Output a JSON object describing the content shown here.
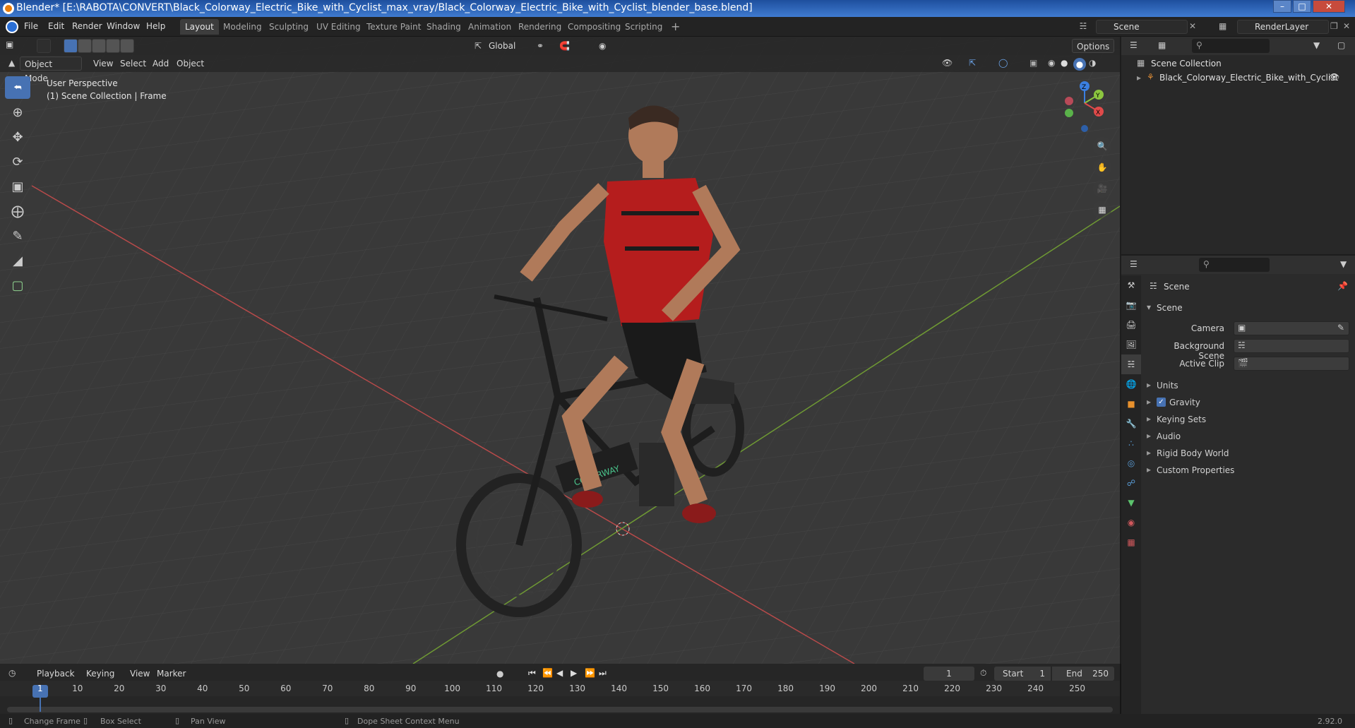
{
  "window": {
    "title": "Blender* [E:\\RABOTA\\CONVERT\\Black_Colorway_Electric_Bike_with_Cyclist_max_vray/Black_Colorway_Electric_Bike_with_Cyclist_blender_base.blend]"
  },
  "menubar": {
    "file": "File",
    "edit": "Edit",
    "render": "Render",
    "window": "Window",
    "help": "Help"
  },
  "workspaces": [
    "Layout",
    "Modeling",
    "Sculpting",
    "UV Editing",
    "Texture Paint",
    "Shading",
    "Animation",
    "Rendering",
    "Compositing",
    "Scripting"
  ],
  "scene_selector": {
    "value": "Scene"
  },
  "renderlayer_selector": {
    "value": "RenderLayer"
  },
  "viewport": {
    "mode": "Object Mode",
    "menus": {
      "view": "View",
      "select": "Select",
      "add": "Add",
      "object": "Object"
    },
    "transform_orientation": "Global",
    "options_label": "Options",
    "overlay_line1": "User Perspective",
    "overlay_line2": "(1) Scene Collection | Frame",
    "gizmo_axes": {
      "x": "X",
      "y": "Y",
      "z": "Z"
    }
  },
  "outliner": {
    "collection": "Scene Collection",
    "items": [
      {
        "label": "Black_Colorway_Electric_Bike_with_Cyclist"
      }
    ]
  },
  "properties": {
    "context": "Scene",
    "panel_title": "Scene",
    "fields": {
      "camera": "Camera",
      "background_scene": "Background Scene",
      "active_clip": "Active Clip"
    },
    "panels": [
      "Units",
      "Gravity",
      "Keying Sets",
      "Audio",
      "Rigid Body World",
      "Custom Properties"
    ],
    "gravity_checked": true
  },
  "timeline": {
    "menus": {
      "playback": "Playback",
      "keying": "Keying",
      "view": "View",
      "marker": "Marker"
    },
    "current_frame": "1",
    "start_label": "Start",
    "start_value": "1",
    "end_label": "End",
    "end_value": "250",
    "ticks": [
      "1",
      "10",
      "20",
      "30",
      "40",
      "50",
      "60",
      "70",
      "80",
      "90",
      "100",
      "110",
      "120",
      "130",
      "140",
      "150",
      "160",
      "170",
      "180",
      "190",
      "200",
      "210",
      "220",
      "230",
      "240",
      "250"
    ]
  },
  "statusbar": {
    "change_frame": "Change Frame",
    "box_select": "Box Select",
    "pan_view": "Pan View",
    "dope_sheet": "Dope Sheet Context Menu",
    "version": "2.92.0"
  }
}
